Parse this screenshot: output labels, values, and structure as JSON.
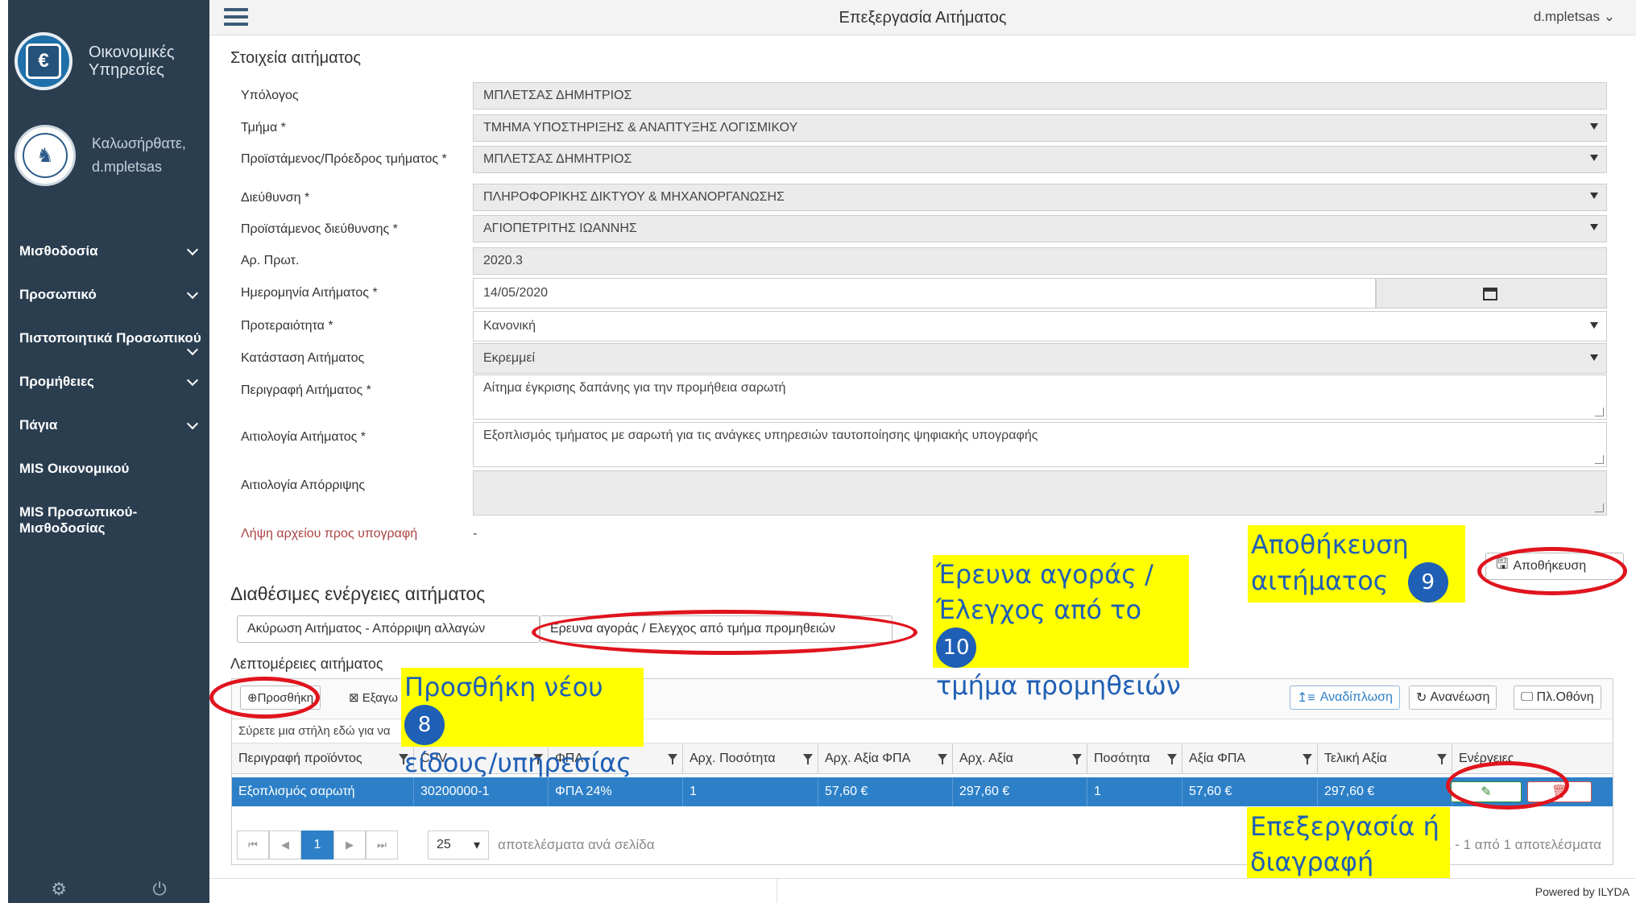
{
  "sidebar": {
    "brand_logo_symbol": "€",
    "brand": "Οικονομικές Υπηρεσίες",
    "welcome": "Καλωσήρθατε,",
    "username": "d.mpletsas",
    "items": [
      {
        "label": "Μισθοδοσία"
      },
      {
        "label": "Προσωπικό"
      },
      {
        "label": "Πιστοποιητικά Προσωπικού"
      },
      {
        "label": "Προμήθειες"
      },
      {
        "label": "Πάγια"
      },
      {
        "label": "MIS Οικονομικού"
      },
      {
        "label": "MIS Προσωπικού-Μισθοδοσίας"
      }
    ],
    "footer_icons": [
      "gear-icon",
      "power-icon"
    ]
  },
  "topbar": {
    "title": "Επεξεργασία Αιτήματος",
    "user": "d.mpletsas"
  },
  "form": {
    "section_title": "Στοιχεία αιτήματος",
    "fields": {
      "ypologos": {
        "label": "Υπόλογος",
        "value": "ΜΠΛΕΤΣΑΣ ΔΗΜΗΤΡΙΟΣ"
      },
      "tmima": {
        "label": "Τμήμα *",
        "value": "ΤΜΗΜΑ ΥΠΟΣΤΗΡΙΞΗΣ & ΑΝΑΠΤΥΞΗΣ ΛΟΓΙΣΜΙΚΟΥ"
      },
      "proistamenos": {
        "label": "Προϊστάμενος/Πρόεδρος τμήματος *",
        "value": "ΜΠΛΕΤΣΑΣ ΔΗΜΗΤΡΙΟΣ"
      },
      "dieythynsi": {
        "label": "Διεύθυνση *",
        "value": "ΠΛΗΡΟΦΟΡΙΚΗΣ ΔΙΚΤΥΟΥ & ΜΗΧΑΝΟΡΓΑΝΩΣΗΣ"
      },
      "proist_dieyth": {
        "label": "Προϊστάμενος διεύθυνσης *",
        "value": "ΑΓΙΟΠΕΤΡΙΤΗΣ ΙΩΑΝΝΗΣ"
      },
      "ar_prot": {
        "label": "Αρ. Πρωτ.",
        "value": "2020.3"
      },
      "imerominia": {
        "label": "Ημερομηνία Αιτήματος *",
        "value": "14/05/2020"
      },
      "proteraiotita": {
        "label": "Προτεραιότητα *",
        "value": "Κανονική"
      },
      "katastasi": {
        "label": "Κατάσταση Αιτήματος",
        "value": "Εκρεμμεί"
      },
      "perigrafi": {
        "label": "Περιγραφή Αιτήματος *",
        "value": "Αίτημα έγκρισης δαπάνης για την προμήθεια σαρωτή"
      },
      "aitiologia": {
        "label": "Αιτιολογία Αιτήματος *",
        "value": "Εξοπλισμός τμήματος με σαρωτή για τις ανάγκες υπηρεσιών ταυτοποίησης ψηφιακής υπογραφής"
      },
      "aporripsi": {
        "label": "Αιτιολογία Απόρριψης",
        "value": ""
      },
      "lipsi": {
        "label": "Λήψη αρχείου προς υπογραφή",
        "value": "-"
      }
    },
    "save_label": "Αποθήκευση"
  },
  "actions": {
    "section_title": "Διαθέσιμες ενέργειες αιτήματος",
    "buttons": [
      "Ακύρωση Αιτήματος - Απόρριψη αλλαγών",
      "Ερευνα αγοράς / Ελεγχος από τμήμα προμηθειών"
    ]
  },
  "details": {
    "section_title": "Λεπτομέρειες αιτήματος",
    "toolbar": {
      "add": "Προσθήκη",
      "export": "Εξαγω",
      "wrap": "Αναδίπλωση",
      "refresh": "Ανανέωση",
      "fullscreen": "Πλ.Οθόνη"
    },
    "group_hint": "Σύρετε μια στήλη εδώ για να",
    "columns": [
      "Περιγραφή προϊόντος",
      "CPV",
      "ΦΠΑ",
      "Αρχ. Ποσότητα",
      "Αρχ. Αξία ΦΠΑ",
      "Αρχ. Αξία",
      "Ποσότητα",
      "Αξία ΦΠΑ",
      "Τελική Αξία",
      "Ενέργειες"
    ],
    "rows": [
      [
        "Εξοπλισμός σαρωτή",
        "30200000-1",
        "ΦΠΑ 24%",
        "1",
        "57,60 €",
        "297,60 €",
        "1",
        "57,60 €",
        "297,60 €"
      ]
    ],
    "pager": {
      "current": "1",
      "page_size": "25",
      "per_page_label": "αποτελέσματα ανά σελίδα",
      "summary": "1 - 1 από 1 αποτελέσματα"
    }
  },
  "annotations": {
    "a8": {
      "text_line1": "Προσθήκη νέου",
      "text_line2": "είδους/υπηρεσίας",
      "num": "8"
    },
    "a9": {
      "text_line1": "Αποθήκευση",
      "text_line2": "αιτήματος",
      "num": "9"
    },
    "a10": {
      "text_line1": "Έρευνα αγοράς /",
      "text_line2": "Έλεγχος από το",
      "text_line3": "τμήμα προμηθειών",
      "num": "10"
    },
    "edit_delete": {
      "text_line1": "Επεξεργασία ή",
      "text_line2": "διαγραφή"
    },
    "highlight_color": "#ffff00",
    "circle_color": "#e0141e"
  },
  "footer": {
    "powered": "Powered by ILYDA"
  }
}
